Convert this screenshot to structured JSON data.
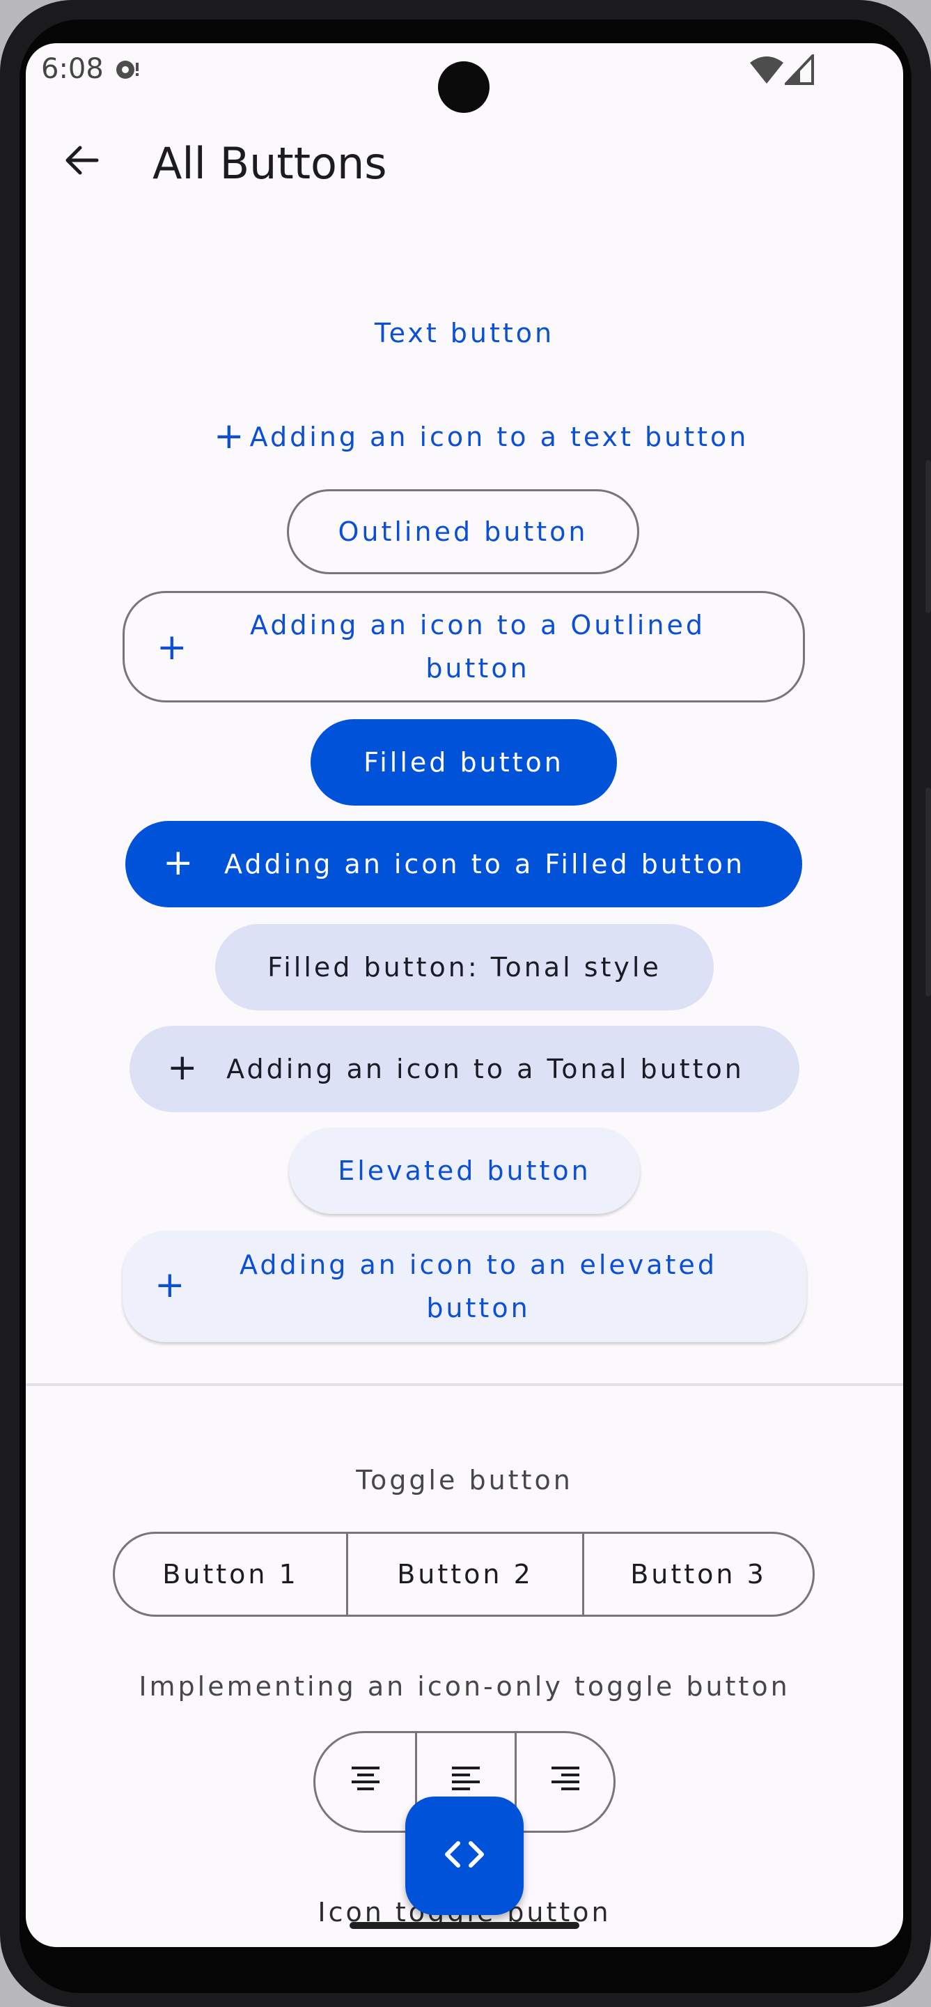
{
  "status_bar": {
    "time": "6:08",
    "icons": [
      "sync-icon",
      "wifi-icon",
      "cell-signal-icon"
    ]
  },
  "top_bar": {
    "title": "All Buttons",
    "back_icon": "arrow-back-icon"
  },
  "buttons": {
    "text_button": "Text button",
    "text_icon_button": "Adding an icon to a text button",
    "outlined_button": "Outlined button",
    "outlined_icon_button_line1": "Adding an icon to a Outlined",
    "outlined_icon_button_line2": "button",
    "filled_button": "Filled button",
    "filled_icon_button": "Adding an icon to a Filled button",
    "tonal_button": "Filled button: Tonal style",
    "tonal_icon_button": "Adding an icon to a Tonal button",
    "elevated_button": "Elevated button",
    "elevated_icon_button_line1": "Adding an icon to an elevated",
    "elevated_icon_button_line2": "button",
    "plus_glyph": "+"
  },
  "toggle_section": {
    "label": "Toggle button",
    "options": [
      "Button 1",
      "Button 2",
      "Button 3"
    ]
  },
  "icon_toggle_section": {
    "label": "Implementing an icon-only toggle button",
    "options": [
      "format-align-center-icon",
      "format-align-left-icon",
      "format-align-right-icon"
    ]
  },
  "icon_toggle_button_label": "Icon toggle button",
  "fab": {
    "icon": "code-icon"
  },
  "colors": {
    "primary": "#0052d9",
    "primary_text": "#0a4fd6",
    "tonal_container": "#dce1f6",
    "elevated_container": "#eef0fb",
    "outline": "#787579",
    "surface": "#fcf9fc"
  }
}
